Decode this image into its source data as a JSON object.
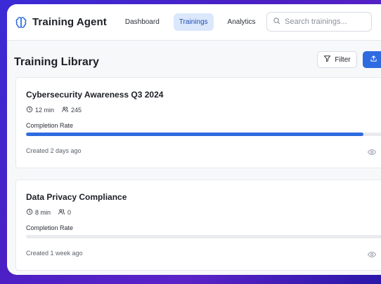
{
  "app": {
    "title": "Training Agent",
    "accent": "#2f6be0"
  },
  "nav": {
    "items": [
      {
        "label": "Dashboard",
        "active": false
      },
      {
        "label": "Trainings",
        "active": true
      },
      {
        "label": "Analytics",
        "active": false
      }
    ]
  },
  "search": {
    "placeholder": "Search trainings...",
    "value": ""
  },
  "page": {
    "title": "Training Library",
    "filter_label": "Filter"
  },
  "trainings": [
    {
      "title": "Cybersecurity Awareness Q3 2024",
      "duration": "12 min",
      "participants": "245",
      "completion_label": "Completion Rate",
      "completion_rate": 0.93,
      "created": "Created 2 days ago"
    },
    {
      "title": "Data Privacy Compliance",
      "duration": "8 min",
      "participants": "0",
      "completion_label": "Completion Rate",
      "completion_rate": 0.0,
      "created": "Created 1 week ago"
    }
  ],
  "icons": {
    "brand": "brain-icon",
    "search": "search-icon",
    "filter": "filter-icon",
    "upload": "upload-icon",
    "clock": "clock-icon",
    "users": "users-icon",
    "view": "eye-icon"
  }
}
